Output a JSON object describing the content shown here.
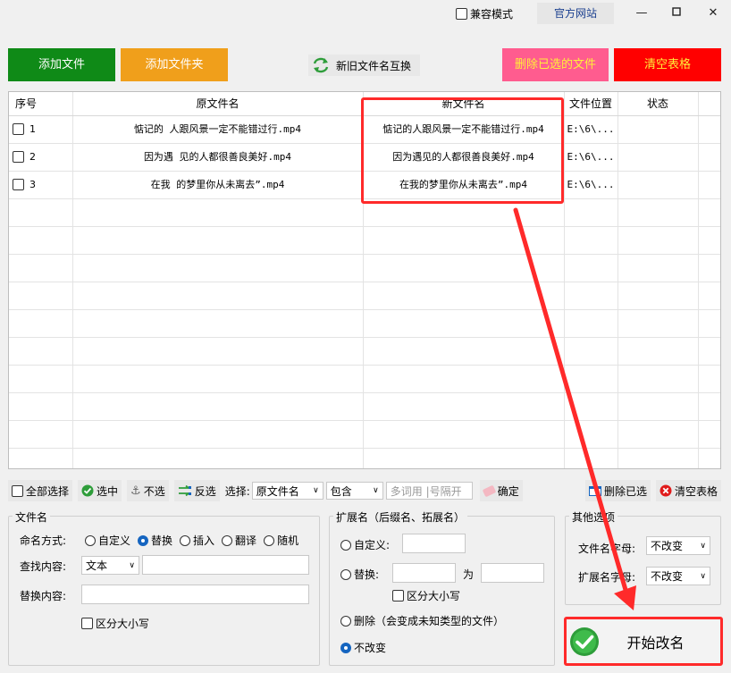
{
  "titlebar": {
    "compat_label": "兼容模式",
    "site_label": "官方网站",
    "min_icon": "minimize-icon",
    "max_icon": "maximize-icon",
    "close_icon": "close-icon"
  },
  "top_buttons": {
    "add_file": "添加文件",
    "add_folder": "添加文件夹",
    "swap_names": "新旧文件名互换",
    "delete_selected": "删除已选的文件",
    "clear_table": "清空表格"
  },
  "colors": {
    "add_file": "#0f8a17",
    "add_folder": "#f09f1b",
    "delete_selected": "#ff5c8f",
    "clear_table": "#ff0000",
    "annotation": "#ff2a2a"
  },
  "table": {
    "headers": [
      "序号",
      "原文件名",
      "新文件名",
      "文件位置",
      "状态"
    ],
    "rows": [
      {
        "no": "1",
        "old": "惦记的 人跟风景一定不能错过行.mp4",
        "new": "惦记的人跟风景一定不能错过行.mp4",
        "loc": "E:\\6\\...",
        "status": ""
      },
      {
        "no": "2",
        "old": "因为遇 见的人都很善良美好.mp4",
        "new": "因为遇见的人都很善良美好.mp4",
        "loc": "E:\\6\\...",
        "status": ""
      },
      {
        "no": "3",
        "old": "在我 的梦里你从未离去”.mp4",
        "new": "在我的梦里你从未离去”.mp4",
        "loc": "E:\\6\\...",
        "status": ""
      }
    ]
  },
  "toolbar": {
    "select_all": "全部选择",
    "check": "选中",
    "uncheck": "不选",
    "invert": "反选",
    "select_label": "选择:",
    "field_value": "原文件名",
    "mode_value": "包含",
    "keyword_placeholder": "多词用 |号隔开",
    "confirm": "确定",
    "delete_selected": "删除已选",
    "clear_table": "清空表格"
  },
  "filename_group": {
    "title": "文件名",
    "mode_label": "命名方式:",
    "modes": [
      "自定义",
      "替换",
      "插入",
      "翻译",
      "随机"
    ],
    "selected_mode": "替换",
    "find_label": "查找内容:",
    "find_type": "文本",
    "find_value": "",
    "replace_label": "替换内容:",
    "replace_value": "",
    "case_label": "区分大小写"
  },
  "ext_group": {
    "title": "扩展名（后缀名、拓展名）",
    "custom": "自定义:",
    "replace": "替换:",
    "to": "为",
    "case": "区分大小写",
    "delete": "删除（会变成未知类型的文件）",
    "nochange": "不改变",
    "selected": "不改变"
  },
  "other_group": {
    "title": "其他选项",
    "filename_case_label": "文件名字母:",
    "filename_case_value": "不改变",
    "ext_case_label": "扩展名字母:",
    "ext_case_value": "不改变"
  },
  "start": {
    "label": "开始改名",
    "icon": "check-circle-icon"
  }
}
